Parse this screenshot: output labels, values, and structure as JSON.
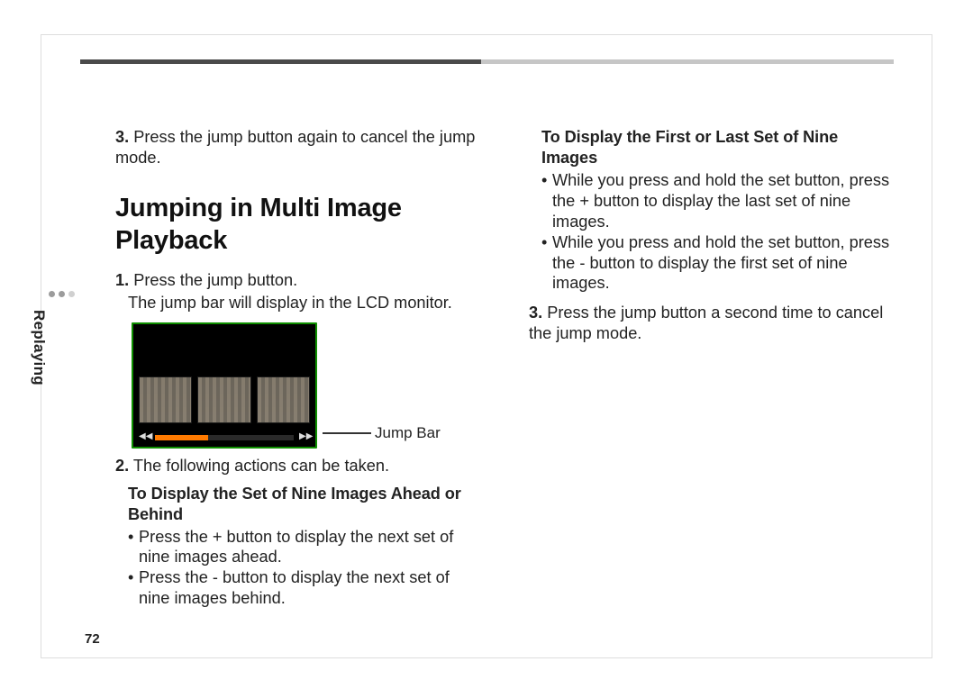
{
  "page_number": "72",
  "side_tab_label": "Replaying",
  "left": {
    "step3_num": "3.",
    "step3_text": " Press the jump button again to cancel the jump mode.",
    "heading": "Jumping in Multi Image Playback",
    "step1_num": "1.",
    "step1_bold_text": " Press the jump button.",
    "step1_sub": "The jump bar will display in the LCD monitor.",
    "jump_bar_label": "Jump Bar",
    "step2_num": "2.",
    "step2_text": " The following actions can be taken.",
    "sub_a_heading": "To Display the Set of Nine Images Ahead or Behind",
    "sub_a_b1": "Press the + button to display the next set of nine images ahead.",
    "sub_a_b2": "Press the - button to display the next set of nine images behind."
  },
  "right": {
    "sub_b_heading": "To Display the First or Last Set of Nine Images",
    "sub_b_b1": "While you press and hold the set button, press the + button to display the last set of nine images.",
    "sub_b_b2": "While you press and hold the set button, press the - button to display the first set of nine images.",
    "step3_num": "3.",
    "step3_text": " Press the jump button a second time to cancel the jump mode."
  },
  "lcd": {
    "rewind_icon": "◀◀",
    "forward_icon": "▶▶"
  }
}
